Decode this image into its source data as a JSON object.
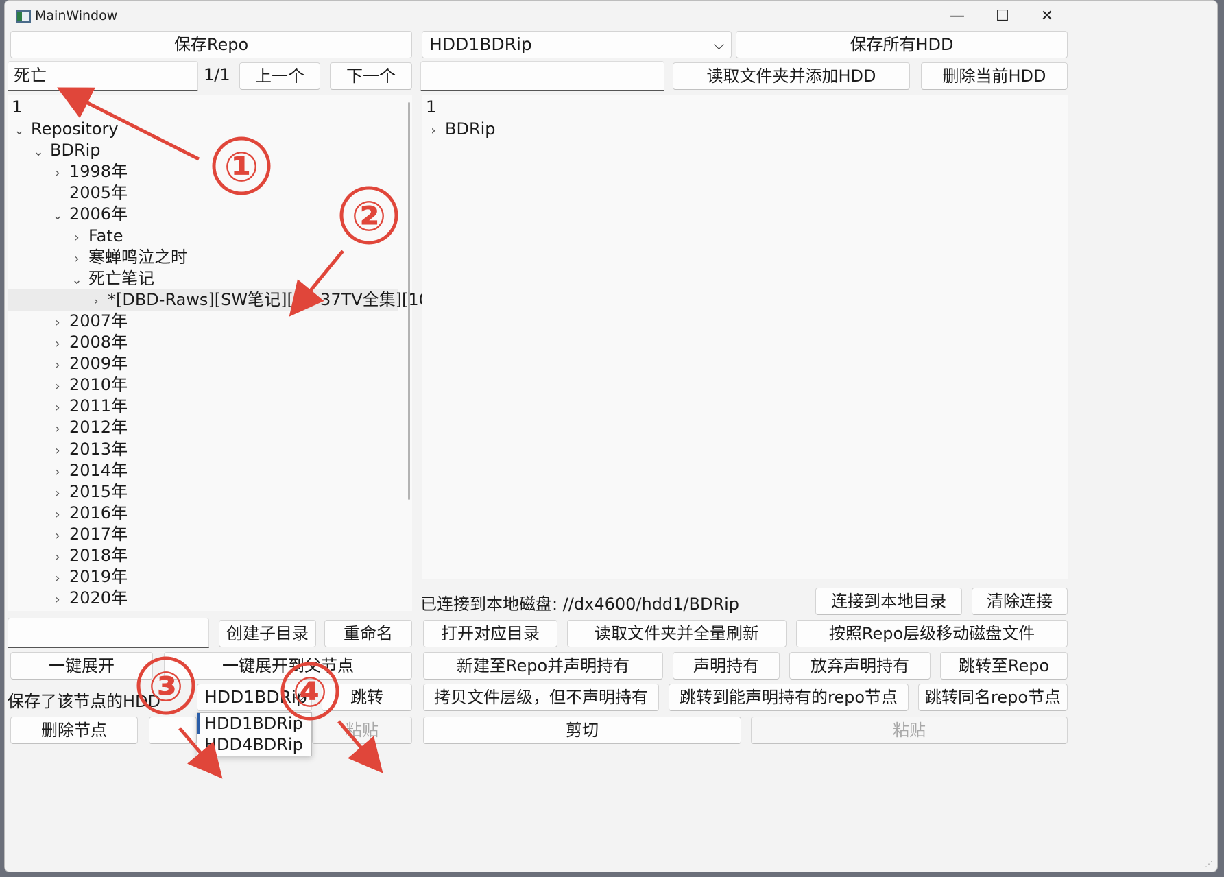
{
  "window": {
    "title": "MainWindow",
    "minimize": "—",
    "maximize": "☐",
    "close": "✕"
  },
  "top": {
    "save_repo": "保存Repo",
    "hdd_combo": "HDD1BDRip",
    "save_all_hdd": "保存所有HDD",
    "search_value": "死亡",
    "match_count": "1/1",
    "prev": "上一个",
    "next": "下一个",
    "hdd_path_value": "",
    "read_folder_add_hdd": "读取文件夹并添加HDD",
    "delete_current_hdd": "删除当前HDD"
  },
  "repo_tree": {
    "header": "1",
    "rows": [
      {
        "label": "Repository",
        "state": "open"
      },
      {
        "label": "BDRip",
        "state": "open"
      },
      {
        "label": "1998年",
        "state": "closed"
      },
      {
        "label": "2005年",
        "state": "none"
      },
      {
        "label": "2006年",
        "state": "open"
      },
      {
        "label": "Fate",
        "state": "closed"
      },
      {
        "label": "寒蝉鸣泣之时",
        "state": "closed"
      },
      {
        "label": "死亡笔记",
        "state": "open"
      },
      {
        "label": "*[DBD-Raws][SW笔记][01-37TV全集][10...",
        "state": "closed"
      },
      {
        "label": "2007年",
        "state": "closed"
      },
      {
        "label": "2008年",
        "state": "closed"
      },
      {
        "label": "2009年",
        "state": "closed"
      },
      {
        "label": "2010年",
        "state": "closed"
      },
      {
        "label": "2011年",
        "state": "closed"
      },
      {
        "label": "2012年",
        "state": "closed"
      },
      {
        "label": "2013年",
        "state": "closed"
      },
      {
        "label": "2014年",
        "state": "closed"
      },
      {
        "label": "2015年",
        "state": "closed"
      },
      {
        "label": "2016年",
        "state": "closed"
      },
      {
        "label": "2017年",
        "state": "closed"
      },
      {
        "label": "2018年",
        "state": "closed"
      },
      {
        "label": "2019年",
        "state": "closed"
      },
      {
        "label": "2020年",
        "state": "closed"
      }
    ]
  },
  "hdd_tree": {
    "header": "1",
    "rows": [
      {
        "label": "BDRip",
        "state": "closed"
      }
    ]
  },
  "left_bottom": {
    "new_name_value": "",
    "create_subdir": "创建子目录",
    "rename": "重命名",
    "expand_all": "一键展开",
    "expand_to_parent": "一键展开到父节点",
    "saved_hdd_label": "保存了该节点的HDD",
    "saved_hdd_combo": "HDD1BDRip",
    "jump": "跳转",
    "delete_node": "删除节点",
    "paste": "粘贴",
    "dropdown_options": [
      "HDD1BDRip",
      "HDD4BDRip"
    ]
  },
  "right_bottom": {
    "connected_status": "已连接到本地磁盘: //dx4600/hdd1/BDRip",
    "connect_local": "连接到本地目录",
    "clear_connection": "清除连接",
    "open_dir": "打开对应目录",
    "read_full_refresh": "读取文件夹并全量刷新",
    "move_by_repo": "按照Repo层级移动磁盘文件",
    "new_to_repo_claim": "新建至Repo并声明持有",
    "claim": "声明持有",
    "abandon_claim": "放弃声明持有",
    "jump_to_repo": "跳转至Repo",
    "copy_hierarchy": "拷贝文件层级，但不声明持有",
    "jump_claimable": "跳转到能声明持有的repo节点",
    "jump_same_name": "跳转同名repo节点",
    "cut": "剪切",
    "paste": "粘贴"
  },
  "annotations": {
    "m1": "①",
    "m2": "②",
    "m3": "③",
    "m4": "④",
    "color": "#e0463a"
  }
}
